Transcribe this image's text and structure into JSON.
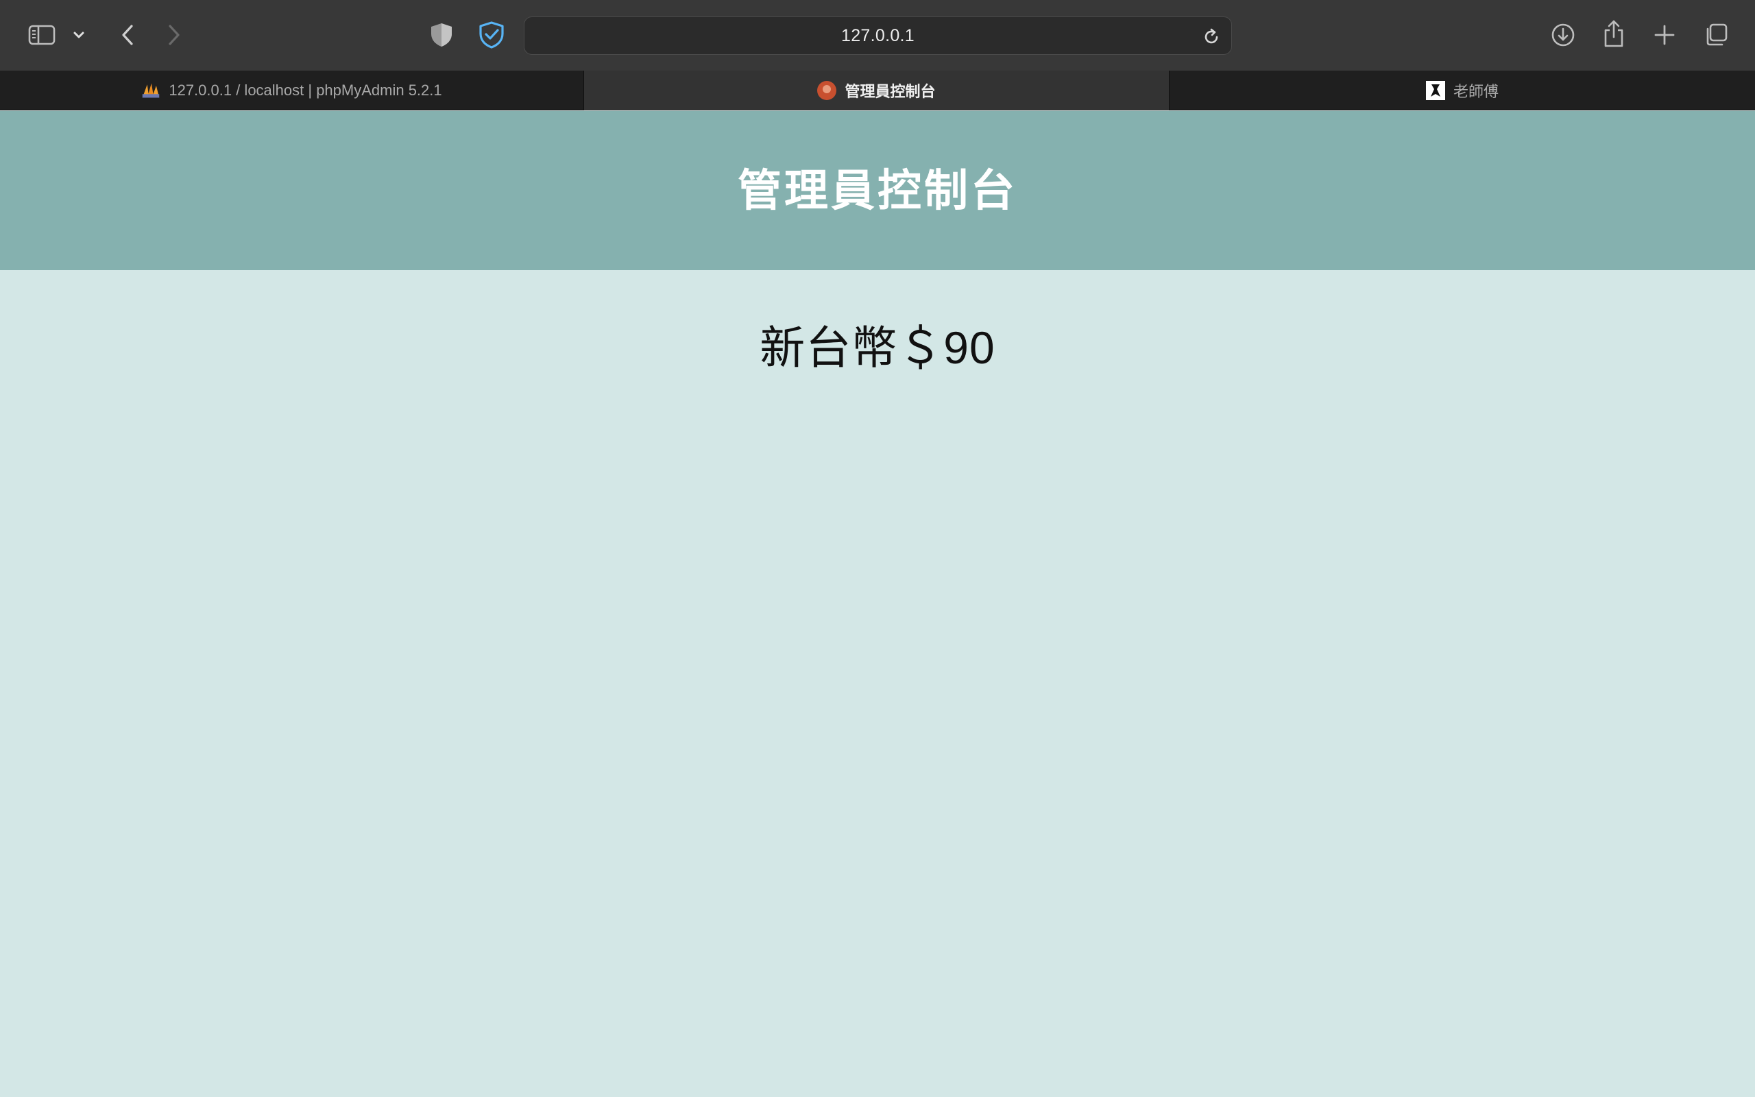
{
  "browser": {
    "url": "127.0.0.1",
    "tabs": [
      {
        "label": "127.0.0.1 / localhost | phpMyAdmin 5.2.1",
        "icon": "phpmyadmin-icon",
        "active": false
      },
      {
        "label": "管理員控制台",
        "icon": "admin-avatar-icon",
        "active": true
      },
      {
        "label": "老師傅",
        "icon": "teacher-site-icon",
        "active": false
      }
    ]
  },
  "page": {
    "header_title": "管理員控制台",
    "price_text": "新台幣＄90"
  },
  "colors": {
    "toolbar_bg": "#383838",
    "tabstrip_bg": "#1f1f1f",
    "active_tab_bg": "#333333",
    "header_bg": "#85b1af",
    "body_bg": "#d3e7e6"
  }
}
